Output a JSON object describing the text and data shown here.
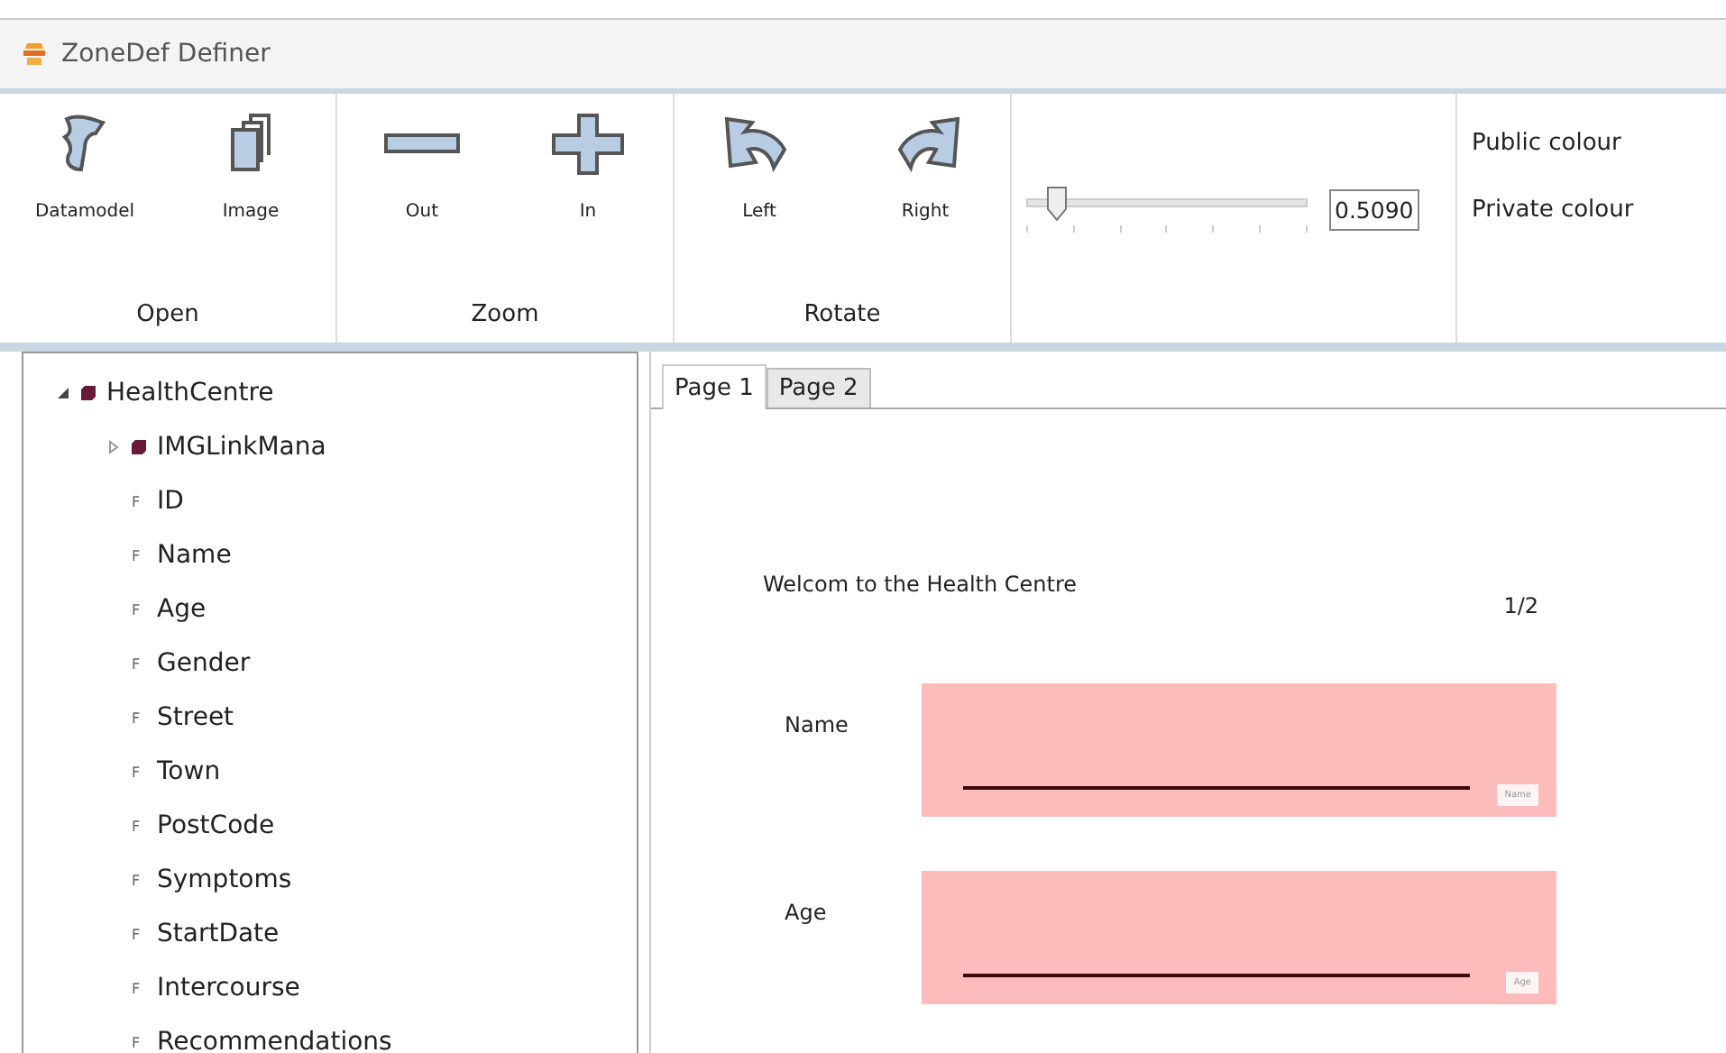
{
  "window": {
    "title": "ZoneDef Definer"
  },
  "ribbon": {
    "groups": [
      {
        "label": "Open",
        "buttons": [
          {
            "label": "Datamodel"
          },
          {
            "label": "Image"
          }
        ]
      },
      {
        "label": "Zoom",
        "buttons": [
          {
            "label": "Out"
          },
          {
            "label": "In"
          }
        ]
      },
      {
        "label": "Rotate",
        "buttons": [
          {
            "label": "Left"
          },
          {
            "label": "Right"
          }
        ]
      }
    ],
    "slider": {
      "level": 0.07,
      "value": "0.5090"
    },
    "colours": [
      "Public colour",
      "Private colour"
    ]
  },
  "tree": [
    {
      "label": "HealthCentre",
      "kind": "entity",
      "expanded": true,
      "children": [
        {
          "label": "IMGLinkMana",
          "kind": "entity",
          "expanded": false
        },
        {
          "label": "ID",
          "kind": "field",
          "marker": "F"
        },
        {
          "label": "Name",
          "kind": "field",
          "marker": "F"
        },
        {
          "label": "Age",
          "kind": "field",
          "marker": "F"
        },
        {
          "label": "Gender",
          "kind": "field",
          "marker": "F"
        },
        {
          "label": "Street",
          "kind": "field",
          "marker": "F"
        },
        {
          "label": "Town",
          "kind": "field",
          "marker": "F"
        },
        {
          "label": "PostCode",
          "kind": "field",
          "marker": "F"
        },
        {
          "label": "Symptoms",
          "kind": "field",
          "marker": "F"
        },
        {
          "label": "StartDate",
          "kind": "field",
          "marker": "F"
        },
        {
          "label": "Intercourse",
          "kind": "field",
          "marker": "F"
        },
        {
          "label": "Recommendations",
          "kind": "field",
          "marker": "F"
        }
      ]
    }
  ],
  "tabs": [
    {
      "label": "Page 1",
      "selected": true
    },
    {
      "label": "Page 2",
      "selected": false
    }
  ],
  "page": {
    "heading": "Welcom to the Health Centre",
    "page_number": "1/2",
    "zones": [
      {
        "label": "Name",
        "tag": "Name"
      },
      {
        "label": "Age",
        "tag": "Age"
      }
    ]
  }
}
